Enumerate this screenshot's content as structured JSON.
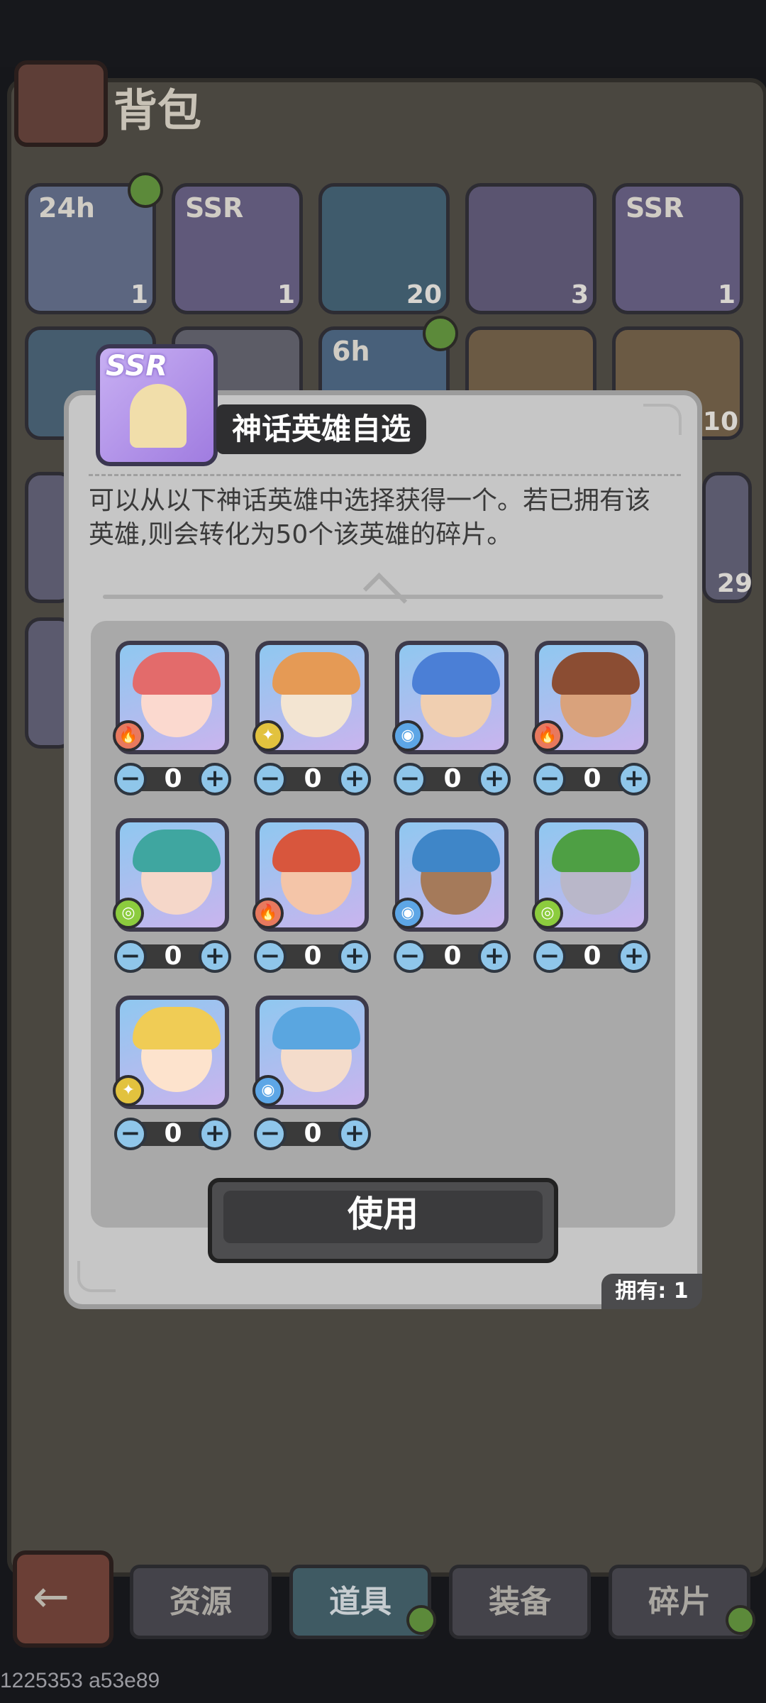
{
  "backpack": {
    "title": "背包",
    "slots": [
      {
        "tag": "24h",
        "count": "1",
        "color": "#5c6680"
      },
      {
        "tag": "SSR",
        "count": "1",
        "color": "#60597a"
      },
      {
        "tag": "",
        "count": "20",
        "color": "#3f5b6c"
      },
      {
        "tag": "",
        "count": "3",
        "color": "#5a5470"
      },
      {
        "tag": "SSR",
        "count": "1",
        "color": "#60597a"
      },
      {
        "tag": "",
        "count": "",
        "color": "#455c6e"
      },
      {
        "tag": "",
        "count": "",
        "color": "#5c5c66"
      },
      {
        "tag": "6h",
        "count": "",
        "color": "#48607a"
      },
      {
        "tag": "",
        "count": "",
        "color": "#6b5a44"
      },
      {
        "tag": "",
        "count": "10",
        "color": "#6b5a44"
      }
    ],
    "side_counts": {
      "row2": "10",
      "row3": "29"
    }
  },
  "dialog": {
    "item_badge": "SSR",
    "title": "神话英雄自选",
    "description_line1": "可以从以下神话英雄中选择获得一个。若已拥有该",
    "description_line2": "英雄,则会转化为50个该英雄的碎片。",
    "heroes": [
      {
        "element": "fire",
        "element_icon": "🔥",
        "quantity": "0",
        "hair": "#e36b6b",
        "skin": "#fbd9cf",
        "element_color": "#e8795e"
      },
      {
        "element": "light",
        "element_icon": "✦",
        "quantity": "0",
        "hair": "#e59a55",
        "skin": "#f3e5d2",
        "element_color": "#e2c23e"
      },
      {
        "element": "water",
        "element_icon": "◉",
        "quantity": "0",
        "hair": "#4b7fd6",
        "skin": "#f0cfb1",
        "element_color": "#5da6e6"
      },
      {
        "element": "fire",
        "element_icon": "🔥",
        "quantity": "0",
        "hair": "#8b4d33",
        "skin": "#d9a27c",
        "element_color": "#e8795e"
      },
      {
        "element": "wind",
        "element_icon": "◎",
        "quantity": "0",
        "hair": "#3fa6a0",
        "skin": "#f5d7c9",
        "element_color": "#8ccc3e"
      },
      {
        "element": "fire",
        "element_icon": "🔥",
        "quantity": "0",
        "hair": "#d8563d",
        "skin": "#f4c5a8",
        "element_color": "#e8795e"
      },
      {
        "element": "water",
        "element_icon": "◉",
        "quantity": "0",
        "hair": "#3f86c8",
        "skin": "#a57a5a",
        "element_color": "#5da6e6"
      },
      {
        "element": "wind",
        "element_icon": "◎",
        "quantity": "0",
        "hair": "#4e9f44",
        "skin": "#b9b7c9",
        "element_color": "#8ccc3e"
      },
      {
        "element": "light",
        "element_icon": "✦",
        "quantity": "0",
        "hair": "#f0cc55",
        "skin": "#fde3cd",
        "element_color": "#e2c23e"
      },
      {
        "element": "water",
        "element_icon": "◉",
        "quantity": "0",
        "hair": "#5aa6e0",
        "skin": "#f4dccb",
        "element_color": "#5da6e6"
      }
    ],
    "use_button": "使用",
    "owned": "拥有: 1"
  },
  "tabs": [
    {
      "label": "资源",
      "active": false
    },
    {
      "label": "道具",
      "active": true
    },
    {
      "label": "装备",
      "active": false
    },
    {
      "label": "碎片",
      "active": false
    }
  ],
  "back_icon": "←",
  "watermark": "1225353 a53e89"
}
